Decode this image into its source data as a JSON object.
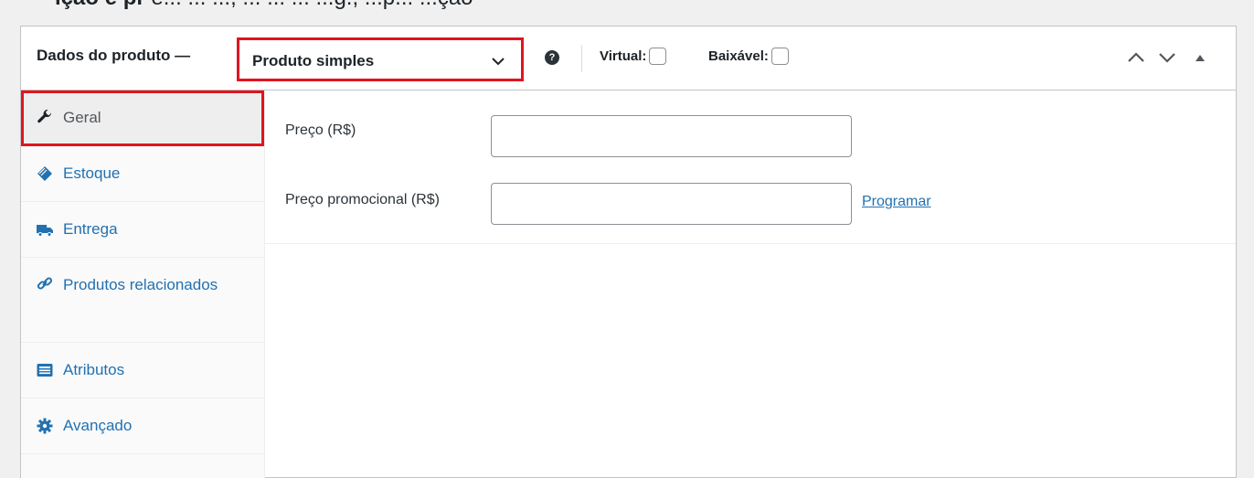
{
  "top_text": {
    "bold": "ição e pr",
    "rest": "e... ...   ..., ...  ... ... ...g., ...p... ...ção"
  },
  "panel": {
    "title": "Dados do produto —",
    "product_type": {
      "selected": "Produto simples"
    },
    "help_icon": "question-circle-icon",
    "virtual_label": "Virtual:",
    "virtual_checked": false,
    "downloadable_label": "Baixável:",
    "downloadable_checked": false
  },
  "tabs": [
    {
      "label": "Geral",
      "icon": "wrench-icon",
      "active": true
    },
    {
      "label": "Estoque",
      "icon": "tag-icon",
      "active": false
    },
    {
      "label": "Entrega",
      "icon": "truck-icon",
      "active": false
    },
    {
      "label": "Produtos relacionados",
      "icon": "link-icon",
      "active": false
    },
    {
      "label": "Atributos",
      "icon": "list-card-icon",
      "active": false
    },
    {
      "label": "Avançado",
      "icon": "gear-icon",
      "active": false
    }
  ],
  "general": {
    "price_label": "Preço (R$)",
    "price_value": "",
    "sale_label": "Preço promocional (R$)",
    "sale_value": "",
    "schedule_link": "Programar"
  },
  "colors": {
    "accent": "#2271b1",
    "highlight": "#e0151e"
  }
}
